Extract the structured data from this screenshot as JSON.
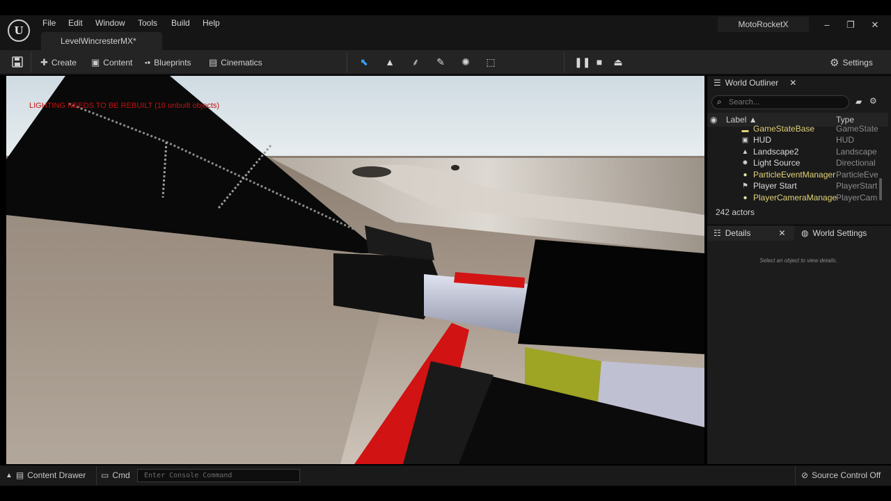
{
  "app": {
    "project_name": "MotoRocketX",
    "menu": [
      "File",
      "Edit",
      "Window",
      "Tools",
      "Build",
      "Help"
    ],
    "level_tab": "LevelWincresterMX*",
    "window_controls": {
      "minimize": "–",
      "restore": "❐",
      "close": "✕"
    }
  },
  "toolbar": {
    "create": "Create",
    "content": "Content",
    "blueprints": "Blueprints",
    "cinematics": "Cinematics",
    "settings": "Settings"
  },
  "viewport": {
    "warning": "LIGHTING NEEDS TO BE REBUILT (10 unbuilt objects)"
  },
  "outliner": {
    "title": "World Outliner",
    "search_placeholder": "Search...",
    "columns": {
      "label": "Label ▲",
      "type": "Type"
    },
    "rows": [
      {
        "label": "GameStateBase",
        "type": "GameState",
        "icon": "actor-icon",
        "color": "#e3d37a"
      },
      {
        "label": "HUD",
        "type": "HUD",
        "icon": "hud-icon",
        "color": "#dadada"
      },
      {
        "label": "Landscape2",
        "type": "Landscape",
        "icon": "landscape-icon",
        "color": "#dadada"
      },
      {
        "label": "Light Source",
        "type": "Directional",
        "icon": "light-icon",
        "color": "#dadada"
      },
      {
        "label": "ParticleEventManager",
        "type": "ParticleEve",
        "icon": "actor-icon",
        "color": "#e3d37a"
      },
      {
        "label": "Player Start",
        "type": "PlayerStart",
        "icon": "flag-icon",
        "color": "#dadada"
      },
      {
        "label": "PlayerCameraManage",
        "type": "PlayerCam",
        "icon": "actor-icon",
        "color": "#e3d37a"
      }
    ],
    "actor_count": "242 actors"
  },
  "details": {
    "title": "Details",
    "world_settings": "World Settings",
    "empty_message": "Select an object to view details."
  },
  "status": {
    "content_drawer": "Content Drawer",
    "cmd": "Cmd",
    "console_placeholder": "Enter Console Command",
    "source_control": "Source Control Off"
  }
}
